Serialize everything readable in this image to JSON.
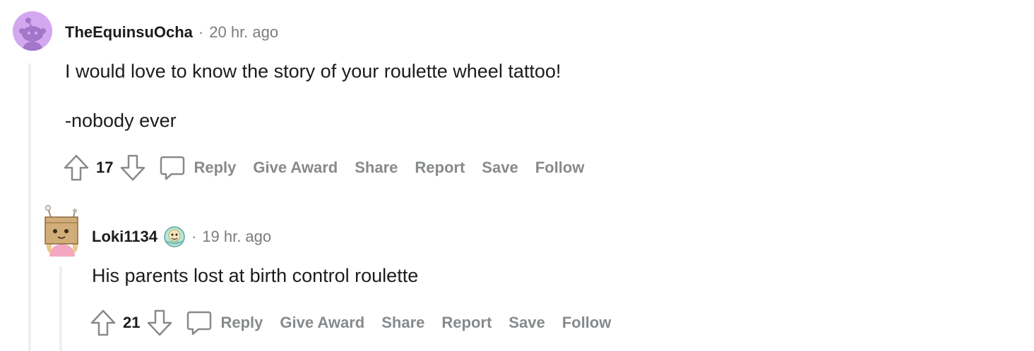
{
  "comments": [
    {
      "username": "TheEquinsuOcha",
      "separator": "·",
      "timestamp": "20 hr. ago",
      "body_lines": [
        "I would love to know the story of your roulette wheel tattoo!",
        "-nobody ever"
      ],
      "score": "17",
      "actions": {
        "reply": "Reply",
        "give_award": "Give Award",
        "share": "Share",
        "report": "Report",
        "save": "Save",
        "follow": "Follow"
      },
      "avatar_icon": "snoo-default-avatar-icon",
      "avatar_color": "#d4a8f0"
    },
    {
      "username": "Loki1134",
      "separator": "·",
      "timestamp": "19 hr. ago",
      "body_lines": [
        "His parents lost at birth control roulette"
      ],
      "score": "21",
      "actions": {
        "reply": "Reply",
        "give_award": "Give Award",
        "share": "Share",
        "report": "Report",
        "save": "Save",
        "follow": "Follow"
      },
      "avatar_icon": "box-head-snoo-avatar-icon",
      "flair_icon": "emoji-flair-icon"
    }
  ],
  "colors": {
    "action_text": "#878a8c",
    "meta_text": "#7c7c7c",
    "thread_line": "#edeff1"
  }
}
